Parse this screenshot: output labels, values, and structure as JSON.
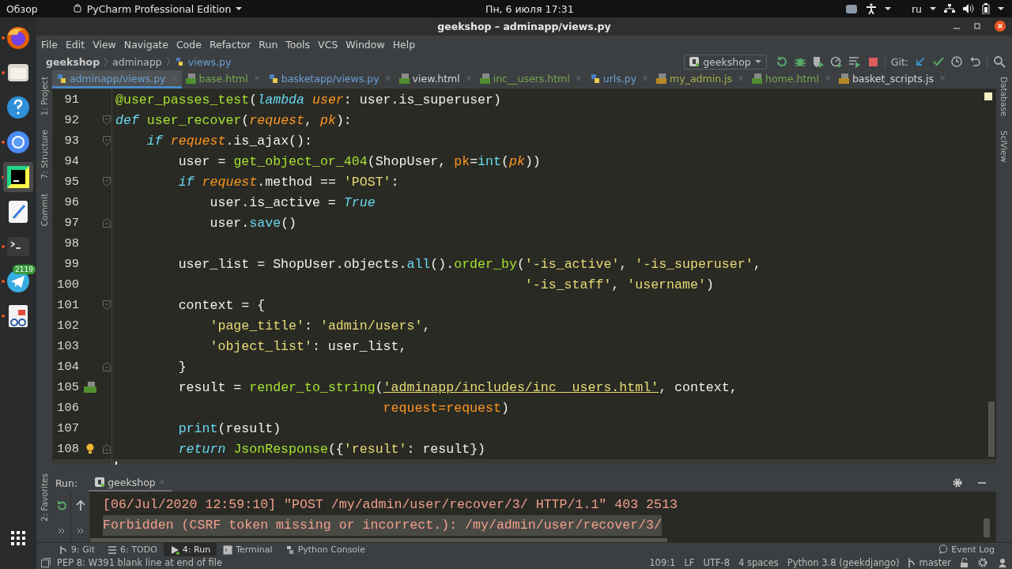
{
  "top_bar": {
    "activities": "Обзор",
    "app_menu": "PyCharm Professional Edition",
    "clock": "Пн, 6 июля  17:31",
    "keyboard_layout": "ru"
  },
  "dock": {
    "items": [
      {
        "kind": "firefox",
        "running": true,
        "selected": false
      },
      {
        "kind": "files",
        "running": true,
        "selected": false
      },
      {
        "kind": "help",
        "running": false,
        "selected": false
      },
      {
        "kind": "chromium",
        "running": true,
        "selected": false
      },
      {
        "kind": "pycharm",
        "running": true,
        "selected": true
      },
      {
        "kind": "editor",
        "running": false,
        "selected": false
      },
      {
        "kind": "terminal",
        "running": true,
        "selected": false
      },
      {
        "kind": "telegram",
        "running": true,
        "selected": false,
        "badge": "2119"
      },
      {
        "kind": "viewer",
        "running": true,
        "selected": false
      }
    ]
  },
  "window": {
    "title": "geekshop – adminapp/views.py"
  },
  "menu": [
    "File",
    "Edit",
    "View",
    "Navigate",
    "Code",
    "Refactor",
    "Run",
    "Tools",
    "VCS",
    "Window",
    "Help"
  ],
  "breadcrumbs": [
    "geekshop",
    "adminapp",
    "views.py"
  ],
  "toolbar": {
    "run_config": "geekshop",
    "git_label": "Git:"
  },
  "tabs": [
    {
      "label": "adminapp/views.py",
      "kind": "py",
      "color": "#6a9fd4",
      "selected": true
    },
    {
      "label": "base.html",
      "kind": "html",
      "color": "#79a64e",
      "selected": false
    },
    {
      "label": "basketapp/views.py",
      "kind": "py",
      "color": "#6a9fd4",
      "selected": false
    },
    {
      "label": "view.html",
      "kind": "html",
      "color": "#d4d4d4",
      "selected": false
    },
    {
      "label": "inc__users.html",
      "kind": "html",
      "color": "#79a64e",
      "selected": false
    },
    {
      "label": "urls.py",
      "kind": "py",
      "color": "#6a9fd4",
      "selected": false
    },
    {
      "label": "my_admin.js",
      "kind": "js",
      "color": "#a8b04a",
      "selected": false
    },
    {
      "label": "home.html",
      "kind": "html",
      "color": "#79a64e",
      "selected": false
    },
    {
      "label": "basket_scripts.js",
      "kind": "js",
      "color": "#d4d4d4",
      "selected": false
    }
  ],
  "left_tools": [
    "1: Project",
    "7: Structure",
    "Commit"
  ],
  "left_tools_bottom": [
    "2: Favorites"
  ],
  "right_tools": [
    "Database",
    "SciView"
  ],
  "editor": {
    "lines": [
      {
        "number": "91",
        "tokens": [
          {
            "kind": "deco",
            "text": "@user_passes_test"
          },
          {
            "kind": "plain",
            "text": "("
          },
          {
            "kind": "kw",
            "text": "lambda "
          },
          {
            "kind": "param",
            "text": "user"
          },
          {
            "kind": "plain",
            "text": ": user.is_superuser)"
          }
        ]
      },
      {
        "number": "92",
        "fold": {
          "kind": "start"
        },
        "tokens": [
          {
            "kind": "kw",
            "text": "def "
          },
          {
            "kind": "fn",
            "text": "user_recover"
          },
          {
            "kind": "plain",
            "text": "("
          },
          {
            "kind": "param",
            "text": "request"
          },
          {
            "kind": "plain",
            "text": ", "
          },
          {
            "kind": "param",
            "text": "pk"
          },
          {
            "kind": "plain",
            "text": "):"
          }
        ]
      },
      {
        "number": "93",
        "fold": {
          "kind": "start"
        },
        "tokens": [
          {
            "kind": "kw",
            "text": "    if "
          },
          {
            "kind": "param",
            "text": "request"
          },
          {
            "kind": "plain",
            "text": ".is_ajax():"
          }
        ]
      },
      {
        "number": "94",
        "tokens": [
          {
            "kind": "plain",
            "text": "        user = "
          },
          {
            "kind": "fn",
            "text": "get_object_or_404"
          },
          {
            "kind": "plain",
            "text": "(ShopUser, "
          },
          {
            "kind": "kwarg",
            "text": "pk"
          },
          {
            "kind": "plain",
            "text": "="
          },
          {
            "kind": "call",
            "text": "int"
          },
          {
            "kind": "plain",
            "text": "("
          },
          {
            "kind": "param",
            "text": "pk"
          },
          {
            "kind": "plain",
            "text": "))"
          }
        ]
      },
      {
        "number": "95",
        "fold": {
          "kind": "start"
        },
        "tokens": [
          {
            "kind": "kw",
            "text": "        if "
          },
          {
            "kind": "param",
            "text": "request"
          },
          {
            "kind": "plain",
            "text": ".method == "
          },
          {
            "kind": "str",
            "text": "'POST'"
          },
          {
            "kind": "plain",
            "text": ":"
          }
        ]
      },
      {
        "number": "96",
        "tokens": [
          {
            "kind": "plain",
            "text": "            user.is_active = "
          },
          {
            "kind": "kw",
            "text": "True"
          }
        ]
      },
      {
        "number": "97",
        "fold": {
          "kind": "end"
        },
        "tokens": [
          {
            "kind": "plain",
            "text": "            user."
          },
          {
            "kind": "call",
            "text": "save"
          },
          {
            "kind": "plain",
            "text": "()"
          }
        ]
      },
      {
        "number": "98"
      },
      {
        "number": "99",
        "tokens": [
          {
            "kind": "plain",
            "text": "        user_list = ShopUser.objects."
          },
          {
            "kind": "call",
            "text": "all"
          },
          {
            "kind": "plain",
            "text": "()."
          },
          {
            "kind": "fn",
            "text": "order_by"
          },
          {
            "kind": "plain",
            "text": "("
          },
          {
            "kind": "str",
            "text": "'-is_active'"
          },
          {
            "kind": "plain",
            "text": ", "
          },
          {
            "kind": "str",
            "text": "'-is_superuser'"
          },
          {
            "kind": "plain",
            "text": ","
          }
        ]
      },
      {
        "number": "100",
        "tokens": [
          {
            "kind": "str",
            "text": "                                                    '-is_staff'"
          },
          {
            "kind": "plain",
            "text": ", "
          },
          {
            "kind": "str",
            "text": "'username'"
          },
          {
            "kind": "plain",
            "text": ")"
          }
        ]
      },
      {
        "number": "101",
        "fold": {
          "kind": "start"
        },
        "tokens": [
          {
            "kind": "plain",
            "text": "        context = {"
          }
        ]
      },
      {
        "number": "102",
        "tokens": [
          {
            "kind": "str",
            "text": "            'page_title'"
          },
          {
            "kind": "plain",
            "text": ": "
          },
          {
            "kind": "str",
            "text": "'admin/users'"
          },
          {
            "kind": "plain",
            "text": ","
          }
        ]
      },
      {
        "number": "103",
        "tokens": [
          {
            "kind": "str",
            "text": "            'object_list'"
          },
          {
            "kind": "plain",
            "text": ": user_list,"
          }
        ]
      },
      {
        "number": "104",
        "fold": {
          "kind": "end"
        },
        "tokens": [
          {
            "kind": "plain",
            "text": "        }"
          }
        ]
      },
      {
        "number": "105",
        "gutter_icon": {
          "kind": "html"
        },
        "tokens": [
          {
            "kind": "plain",
            "text": "        result = "
          },
          {
            "kind": "fn",
            "text": "render_to_string"
          },
          {
            "kind": "plain",
            "text": "("
          },
          {
            "kind": "link",
            "text": "'adminapp/includes/inc__users.html'"
          },
          {
            "kind": "plain",
            "text": ", context,"
          }
        ]
      },
      {
        "number": "106",
        "tokens": [
          {
            "kind": "kwarg",
            "text": "                                  request=request"
          },
          {
            "kind": "plain",
            "text": ")"
          }
        ]
      },
      {
        "number": "107",
        "tokens": [
          {
            "kind": "call",
            "text": "        print"
          },
          {
            "kind": "plain",
            "text": "(result)"
          }
        ]
      },
      {
        "number": "108",
        "fold": {
          "kind": "end"
        },
        "gutter_icon": {
          "kind": "bulb"
        },
        "tokens": [
          {
            "kind": "kw",
            "text": "        return "
          },
          {
            "kind": "fn",
            "text": "JsonResponse"
          },
          {
            "kind": "plain",
            "text": "({"
          },
          {
            "kind": "str",
            "text": "'result'"
          },
          {
            "kind": "plain",
            "text": ": result})"
          }
        ]
      },
      {
        "current": true
      }
    ]
  },
  "run_panel": {
    "label": "Run:",
    "tab": "geekshop",
    "output": [
      {
        "text": "[06/Jul/2020 12:59:10] \"POST /my/admin/user/recover/3/ HTTP/1.1\" 403 2513",
        "highlighted": false
      },
      {
        "text": "Forbidden (CSRF token missing or incorrect.): /my/admin/user/recover/3/",
        "highlighted": true
      }
    ]
  },
  "tool_tabs": [
    {
      "label": "9: Git",
      "kind": "git",
      "selected": false
    },
    {
      "label": "6: TODO",
      "kind": "todo",
      "selected": false
    },
    {
      "label": "4: Run",
      "kind": "run",
      "selected": true
    },
    {
      "label": "Terminal",
      "kind": "terminal",
      "selected": false
    },
    {
      "label": "Python Console",
      "kind": "python",
      "selected": false
    }
  ],
  "event_log": "Event Log",
  "status_bar": {
    "message": "PEP 8: W391 blank line at end of file",
    "items": [
      "109:1",
      "LF",
      "UTF-8",
      "4 spaces",
      "Python 3.8 (geekdjango)"
    ],
    "branch": "master"
  }
}
